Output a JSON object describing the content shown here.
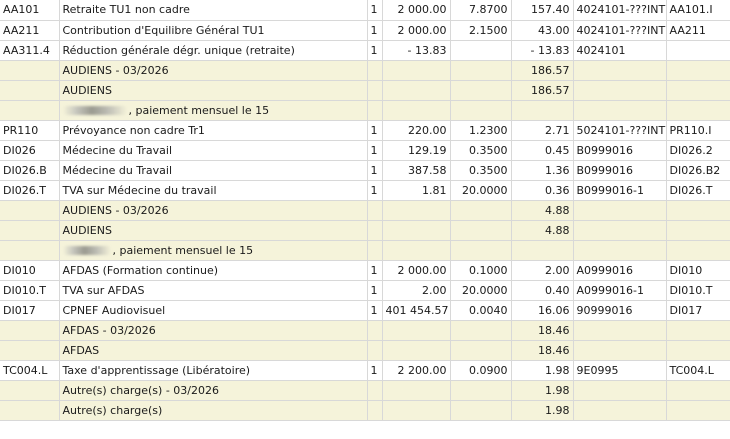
{
  "rows": [
    {
      "type": "line",
      "code": "AA101",
      "label": "Retraite TU1 non cadre",
      "qty": "1",
      "base": "2 000.00",
      "rate": "7.8700",
      "amount": "157.40",
      "account": "4024101-???INT",
      "ref": "AA101.I"
    },
    {
      "type": "line",
      "code": "AA211",
      "label": "Contribution d'Equilibre Général TU1",
      "qty": "1",
      "base": "2 000.00",
      "rate": "2.1500",
      "amount": "43.00",
      "account": "4024101-???INT",
      "ref": "AA211"
    },
    {
      "type": "line",
      "code": "AA311.4",
      "label": "Réduction générale dégr. unique (retraite)",
      "qty": "1",
      "base": "- 13.83",
      "rate": "",
      "amount": "- 13.83",
      "account": "4024101",
      "ref": ""
    },
    {
      "type": "sub",
      "code": "",
      "label": "AUDIENS - 03/2026",
      "qty": "",
      "base": "",
      "rate": "",
      "amount": "186.57",
      "account": "",
      "ref": ""
    },
    {
      "type": "sub",
      "code": "",
      "label": "AUDIENS",
      "qty": "",
      "base": "",
      "rate": "",
      "amount": "186.57",
      "account": "",
      "ref": ""
    },
    {
      "type": "note",
      "label": ", paiement mensuel le 15"
    },
    {
      "type": "line",
      "code": "PR110",
      "label": "Prévoyance non cadre Tr1",
      "qty": "1",
      "base": "220.00",
      "rate": "1.2300",
      "amount": "2.71",
      "account": "5024101-???INT",
      "ref": "PR110.I"
    },
    {
      "type": "line",
      "code": "DI026",
      "label": "Médecine du Travail",
      "qty": "1",
      "base": "129.19",
      "rate": "0.3500",
      "amount": "0.45",
      "account": "B0999016",
      "ref": "DI026.2"
    },
    {
      "type": "line",
      "code": "DI026.B",
      "label": "Médecine du Travail",
      "qty": "1",
      "base": "387.58",
      "rate": "0.3500",
      "amount": "1.36",
      "account": "B0999016",
      "ref": "DI026.B2"
    },
    {
      "type": "line",
      "code": "DI026.T",
      "label": "TVA sur Médecine du travail",
      "qty": "1",
      "base": "1.81",
      "rate": "20.0000",
      "amount": "0.36",
      "account": "B0999016-1",
      "ref": "DI026.T"
    },
    {
      "type": "sub",
      "code": "",
      "label": "AUDIENS - 03/2026",
      "qty": "",
      "base": "",
      "rate": "",
      "amount": "4.88",
      "account": "",
      "ref": ""
    },
    {
      "type": "sub",
      "code": "",
      "label": "AUDIENS",
      "qty": "",
      "base": "",
      "rate": "",
      "amount": "4.88",
      "account": "",
      "ref": ""
    },
    {
      "type": "note",
      "label": ", paiement mensuel le 15"
    },
    {
      "type": "line",
      "code": "DI010",
      "label": "AFDAS (Formation continue)",
      "qty": "1",
      "base": "2 000.00",
      "rate": "0.1000",
      "amount": "2.00",
      "account": "A0999016",
      "ref": "DI010"
    },
    {
      "type": "line",
      "code": "DI010.T",
      "label": "TVA sur AFDAS",
      "qty": "1",
      "base": "2.00",
      "rate": "20.0000",
      "amount": "0.40",
      "account": "A0999016-1",
      "ref": "DI010.T"
    },
    {
      "type": "line",
      "code": "DI017",
      "label": "CPNEF Audiovisuel",
      "qty": "1",
      "base": "401 454.57",
      "rate": "0.0040",
      "amount": "16.06",
      "account": "90999016",
      "ref": "DI017"
    },
    {
      "type": "sub",
      "code": "",
      "label": "AFDAS - 03/2026",
      "qty": "",
      "base": "",
      "rate": "",
      "amount": "18.46",
      "account": "",
      "ref": ""
    },
    {
      "type": "sub",
      "code": "",
      "label": "AFDAS",
      "qty": "",
      "base": "",
      "rate": "",
      "amount": "18.46",
      "account": "",
      "ref": ""
    },
    {
      "type": "line",
      "code": "TC004.L",
      "label": "Taxe d'apprentissage (Libératoire)",
      "qty": "1",
      "base": "2 200.00",
      "rate": "0.0900",
      "amount": "1.98",
      "account": "9E0995",
      "ref": "TC004.L"
    },
    {
      "type": "sub",
      "code": "",
      "label": "Autre(s) charge(s) - 03/2026",
      "qty": "",
      "base": "",
      "rate": "",
      "amount": "1.98",
      "account": "",
      "ref": ""
    },
    {
      "type": "sub",
      "code": "",
      "label": "Autre(s) charge(s)",
      "qty": "",
      "base": "",
      "rate": "",
      "amount": "1.98",
      "account": "",
      "ref": ""
    }
  ]
}
